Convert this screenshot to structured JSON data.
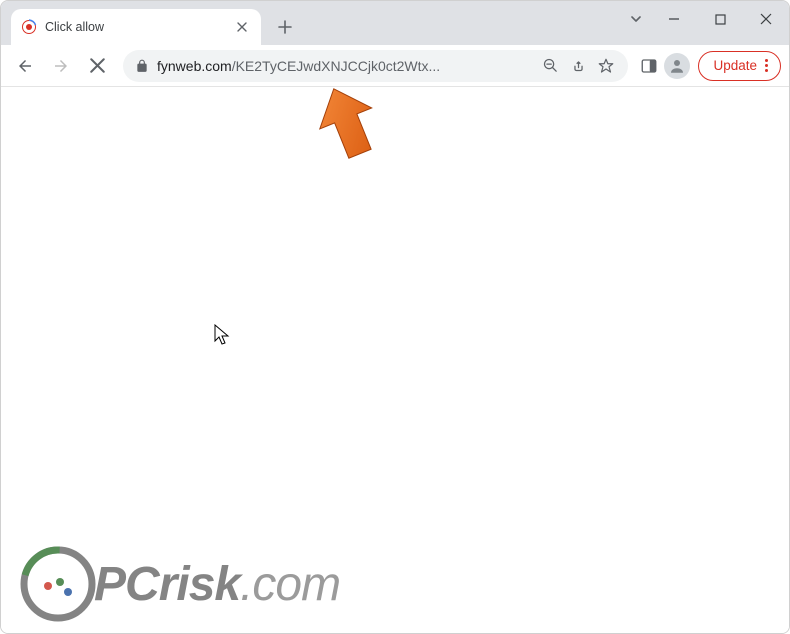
{
  "window": {
    "tab": {
      "title": "Click allow"
    },
    "controls": {
      "dropdown_glyph": "⌄",
      "minimize_glyph": "―",
      "maximize_glyph": "☐",
      "close_glyph": "✕"
    },
    "newtab_glyph": "+"
  },
  "toolbar": {
    "url_domain": "fynweb.com",
    "url_path": "/KE2TyCEJwdXNJCCjk0ct2Wtx...",
    "update_label": "Update"
  },
  "watermark": {
    "brand_strong": "PC",
    "brand_rest": "risk",
    "brand_tld": ".com"
  },
  "colors": {
    "accent_red": "#d93025",
    "arrow_orange": "#e86a17",
    "titlebar_bg": "#dfe1e5",
    "omnibox_bg": "#f1f3f4"
  }
}
